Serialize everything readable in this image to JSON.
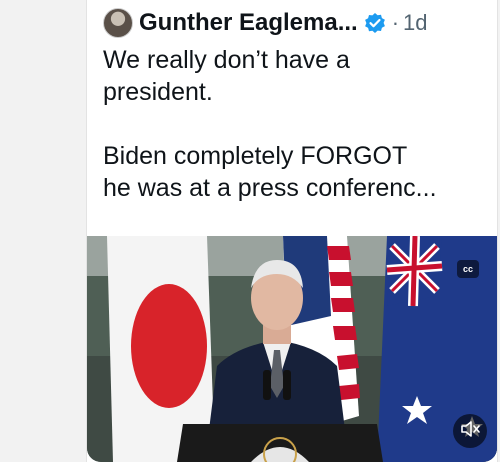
{
  "post": {
    "author_name": "Gunther Eaglema...",
    "separator": "·",
    "timestamp": "1d",
    "text_lines": [
      "We really don’t have a",
      "president.",
      "Biden completely FORGOT",
      "he was at a press conferenc..."
    ],
    "verified_icon": "verified-badge-icon",
    "verified_color": "#1d9bf0"
  },
  "video": {
    "cc_label": "cc",
    "mute_icon": "speaker-muted-icon"
  }
}
